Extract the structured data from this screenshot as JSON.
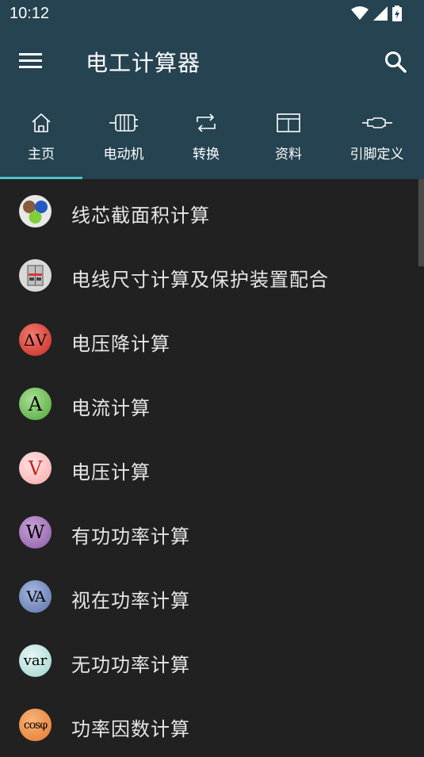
{
  "status": {
    "time": "10:12"
  },
  "appbar": {
    "title": "电工计算器"
  },
  "tabs": [
    {
      "label": "主页",
      "icon": "home-icon",
      "selected": true
    },
    {
      "label": "电动机",
      "icon": "motor-icon",
      "selected": false
    },
    {
      "label": "转换",
      "icon": "convert-icon",
      "selected": false
    },
    {
      "label": "资料",
      "icon": "book-icon",
      "selected": false
    },
    {
      "label": "引脚定义",
      "icon": "connector-icon",
      "selected": false
    }
  ],
  "items": [
    {
      "label": "线芯截面积计算",
      "icon": "wire-core-icon",
      "symbol": ""
    },
    {
      "label": "电线尺寸计算及保护装置配合",
      "icon": "breaker-icon",
      "symbol": ""
    },
    {
      "label": "电压降计算",
      "icon": "voltage-drop-icon",
      "symbol": "ΔV"
    },
    {
      "label": "电流计算",
      "icon": "current-icon",
      "symbol": "A"
    },
    {
      "label": "电压计算",
      "icon": "voltage-icon",
      "symbol": "V"
    },
    {
      "label": "有功功率计算",
      "icon": "active-power-icon",
      "symbol": "W"
    },
    {
      "label": "视在功率计算",
      "icon": "apparent-power-icon",
      "symbol": "VA"
    },
    {
      "label": "无功功率计算",
      "icon": "reactive-power-icon",
      "symbol": "var"
    },
    {
      "label": "功率因数计算",
      "icon": "power-factor-icon",
      "symbol": "cosφ"
    }
  ],
  "colors": {
    "appbar": "#254350",
    "background": "#212121",
    "indicator": "#4fc3c7"
  }
}
